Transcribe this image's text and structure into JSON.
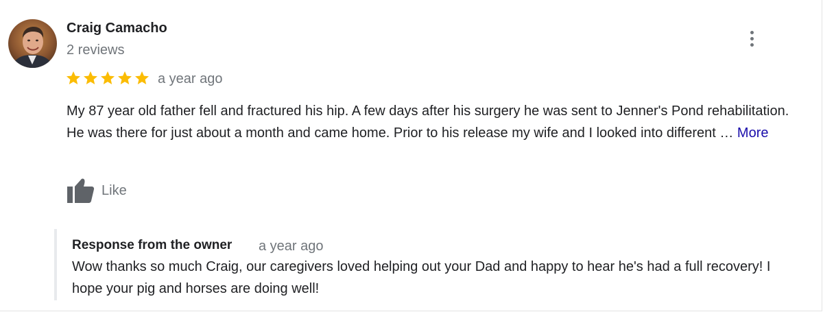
{
  "review": {
    "reviewer_name": "Craig Camacho",
    "review_count": "2 reviews",
    "rating": 5,
    "rating_max": 5,
    "time": "a year ago",
    "text": "My 87 year old father fell and fractured his hip.  A few days after his surgery he was sent to Jenner's Pond rehabilitation.  He was there for just about a month and came home.  Prior to his release my wife and I looked into different …",
    "more_label": "More",
    "like_label": "Like"
  },
  "owner_response": {
    "title": "Response from the owner",
    "time": "a year ago",
    "text": "Wow thanks so much Craig, our caregivers loved helping out your Dad and happy to hear he's had a full recovery! I hope your pig and horses are doing well!"
  },
  "colors": {
    "star": "#fbbc04",
    "secondary_text": "#70757a",
    "link": "#1a0dab",
    "icon": "#5f6368"
  },
  "icons": {
    "more": "more-vert-icon",
    "star": "star-icon",
    "like": "thumbs-up-icon"
  }
}
